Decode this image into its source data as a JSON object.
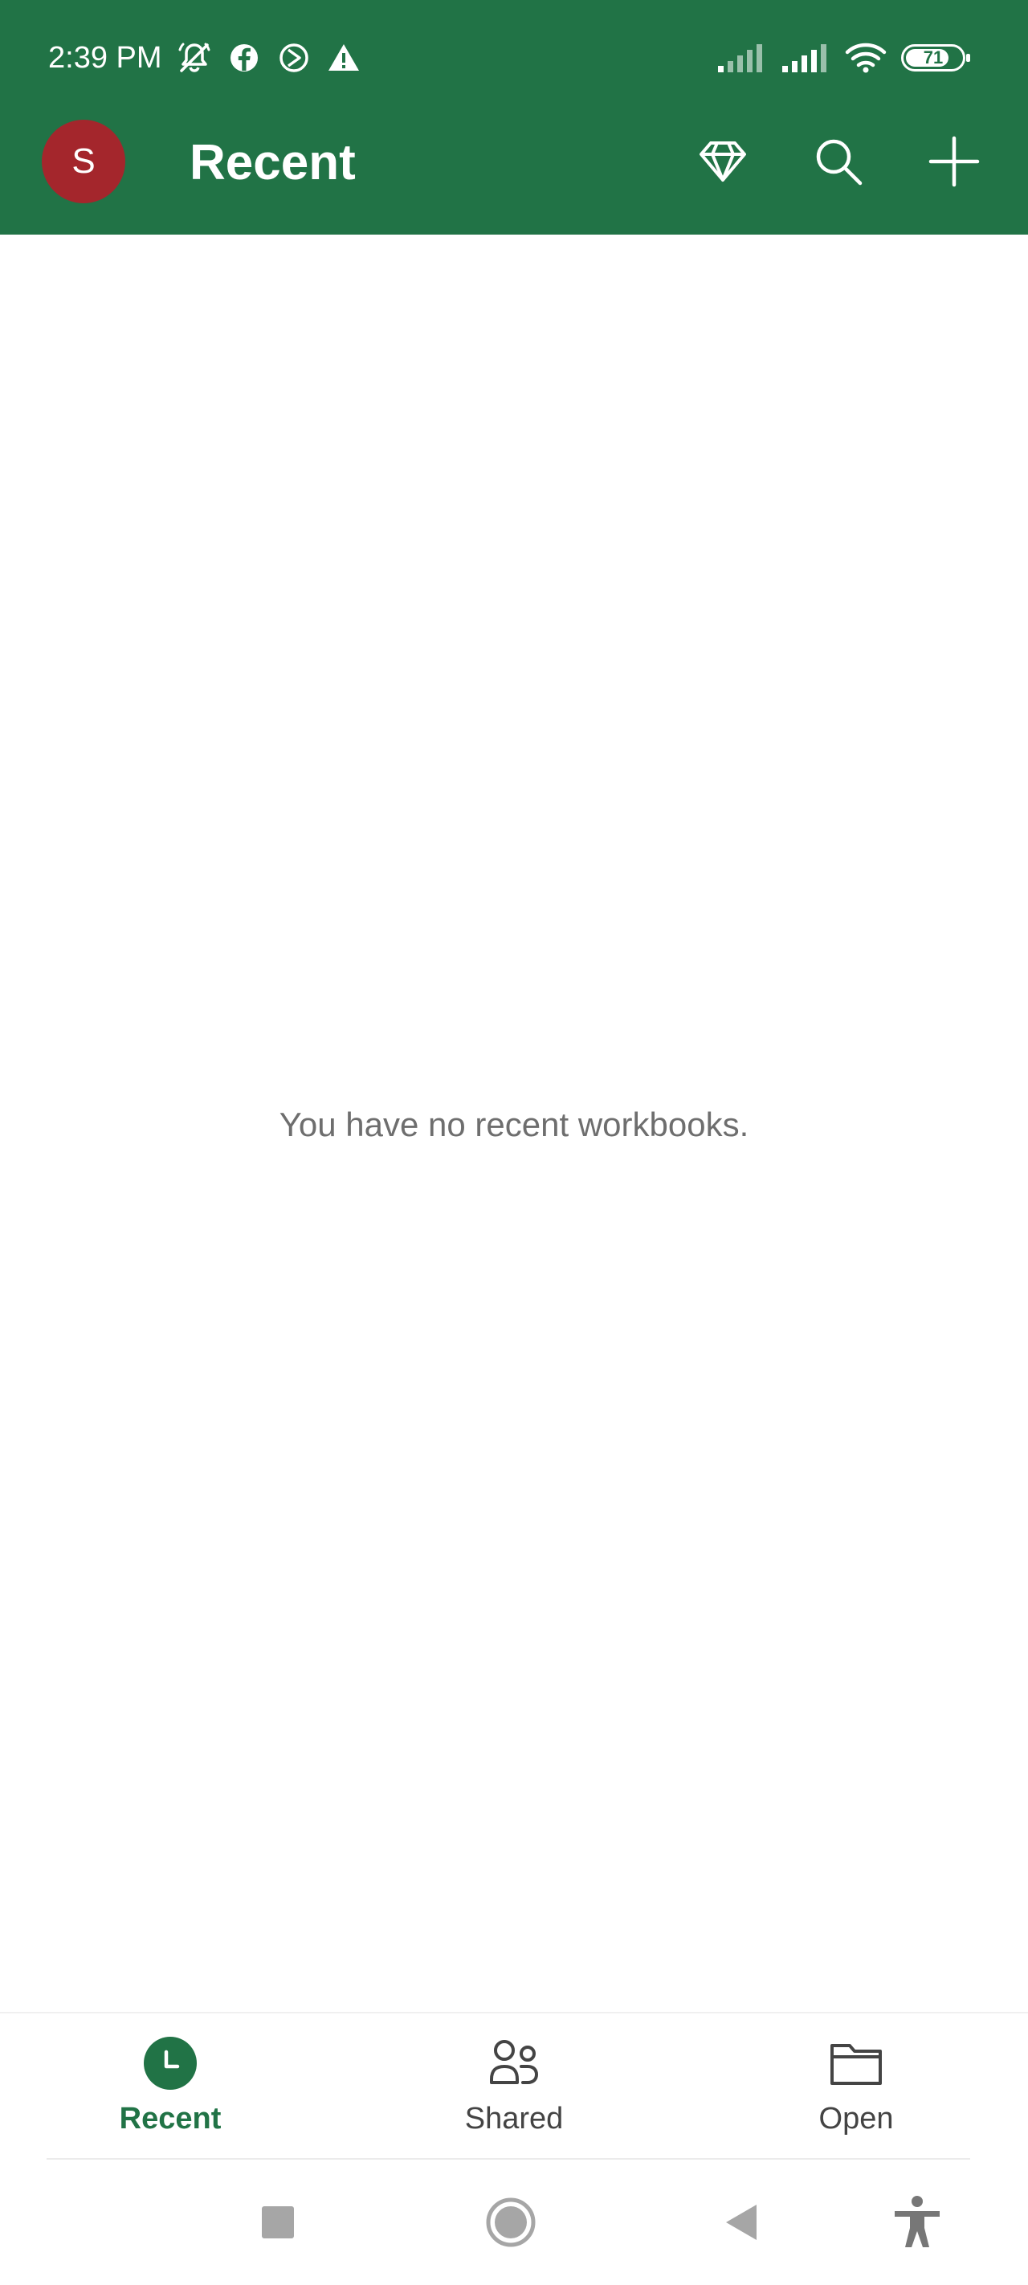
{
  "status_bar": {
    "time": "2:39 PM",
    "battery_level": "71",
    "left_icons": [
      "notifications-muted-icon",
      "facebook-icon",
      "media-player-icon",
      "warning-icon"
    ],
    "right_icons": [
      "cell-signal-1-icon",
      "cell-signal-2-icon",
      "wifi-icon",
      "battery-icon"
    ]
  },
  "app_bar": {
    "avatar_initial": "S",
    "title": "Recent",
    "actions": [
      "premium-diamond-icon",
      "search-icon",
      "add-icon"
    ]
  },
  "main": {
    "empty_message": "You have no recent workbooks."
  },
  "bottom_nav": {
    "items": [
      {
        "label": "Recent",
        "icon": "recent-clock-icon",
        "active": true
      },
      {
        "label": "Shared",
        "icon": "shared-people-icon",
        "active": false
      },
      {
        "label": "Open",
        "icon": "folder-icon",
        "active": false
      }
    ]
  },
  "system_nav": {
    "buttons": [
      "recents-square-icon",
      "home-circle-icon",
      "back-triangle-icon",
      "accessibility-icon"
    ]
  },
  "colors": {
    "brand": "#217346",
    "avatar": "#a4262c",
    "empty_text": "#6e6e6e",
    "nav_label": "#444444",
    "system_nav_icon": "#a6a6a6"
  }
}
